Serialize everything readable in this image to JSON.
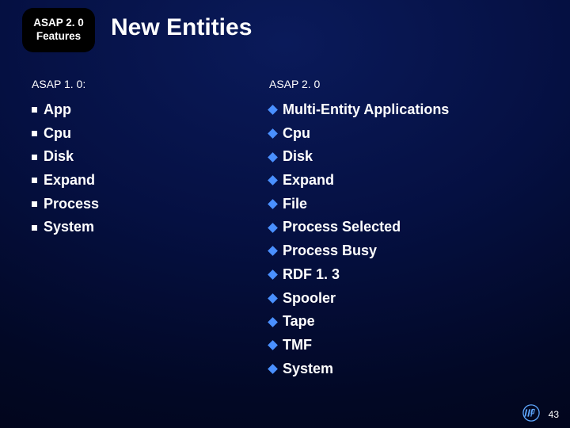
{
  "badge": {
    "line1": "ASAP 2. 0",
    "line2": "Features"
  },
  "title": "New Entities",
  "left": {
    "heading": "ASAP 1. 0:",
    "items": [
      "App",
      "Cpu",
      "Disk",
      "Expand",
      "Process",
      "System"
    ]
  },
  "right": {
    "heading": "ASAP 2. 0",
    "items": [
      "Multi-Entity Applications",
      "Cpu",
      "Disk",
      "Expand",
      "File",
      "Process Selected",
      "Process Busy",
      "RDF 1. 3",
      "Spooler",
      "Tape",
      "TMF",
      "System"
    ]
  },
  "page_number": "43"
}
